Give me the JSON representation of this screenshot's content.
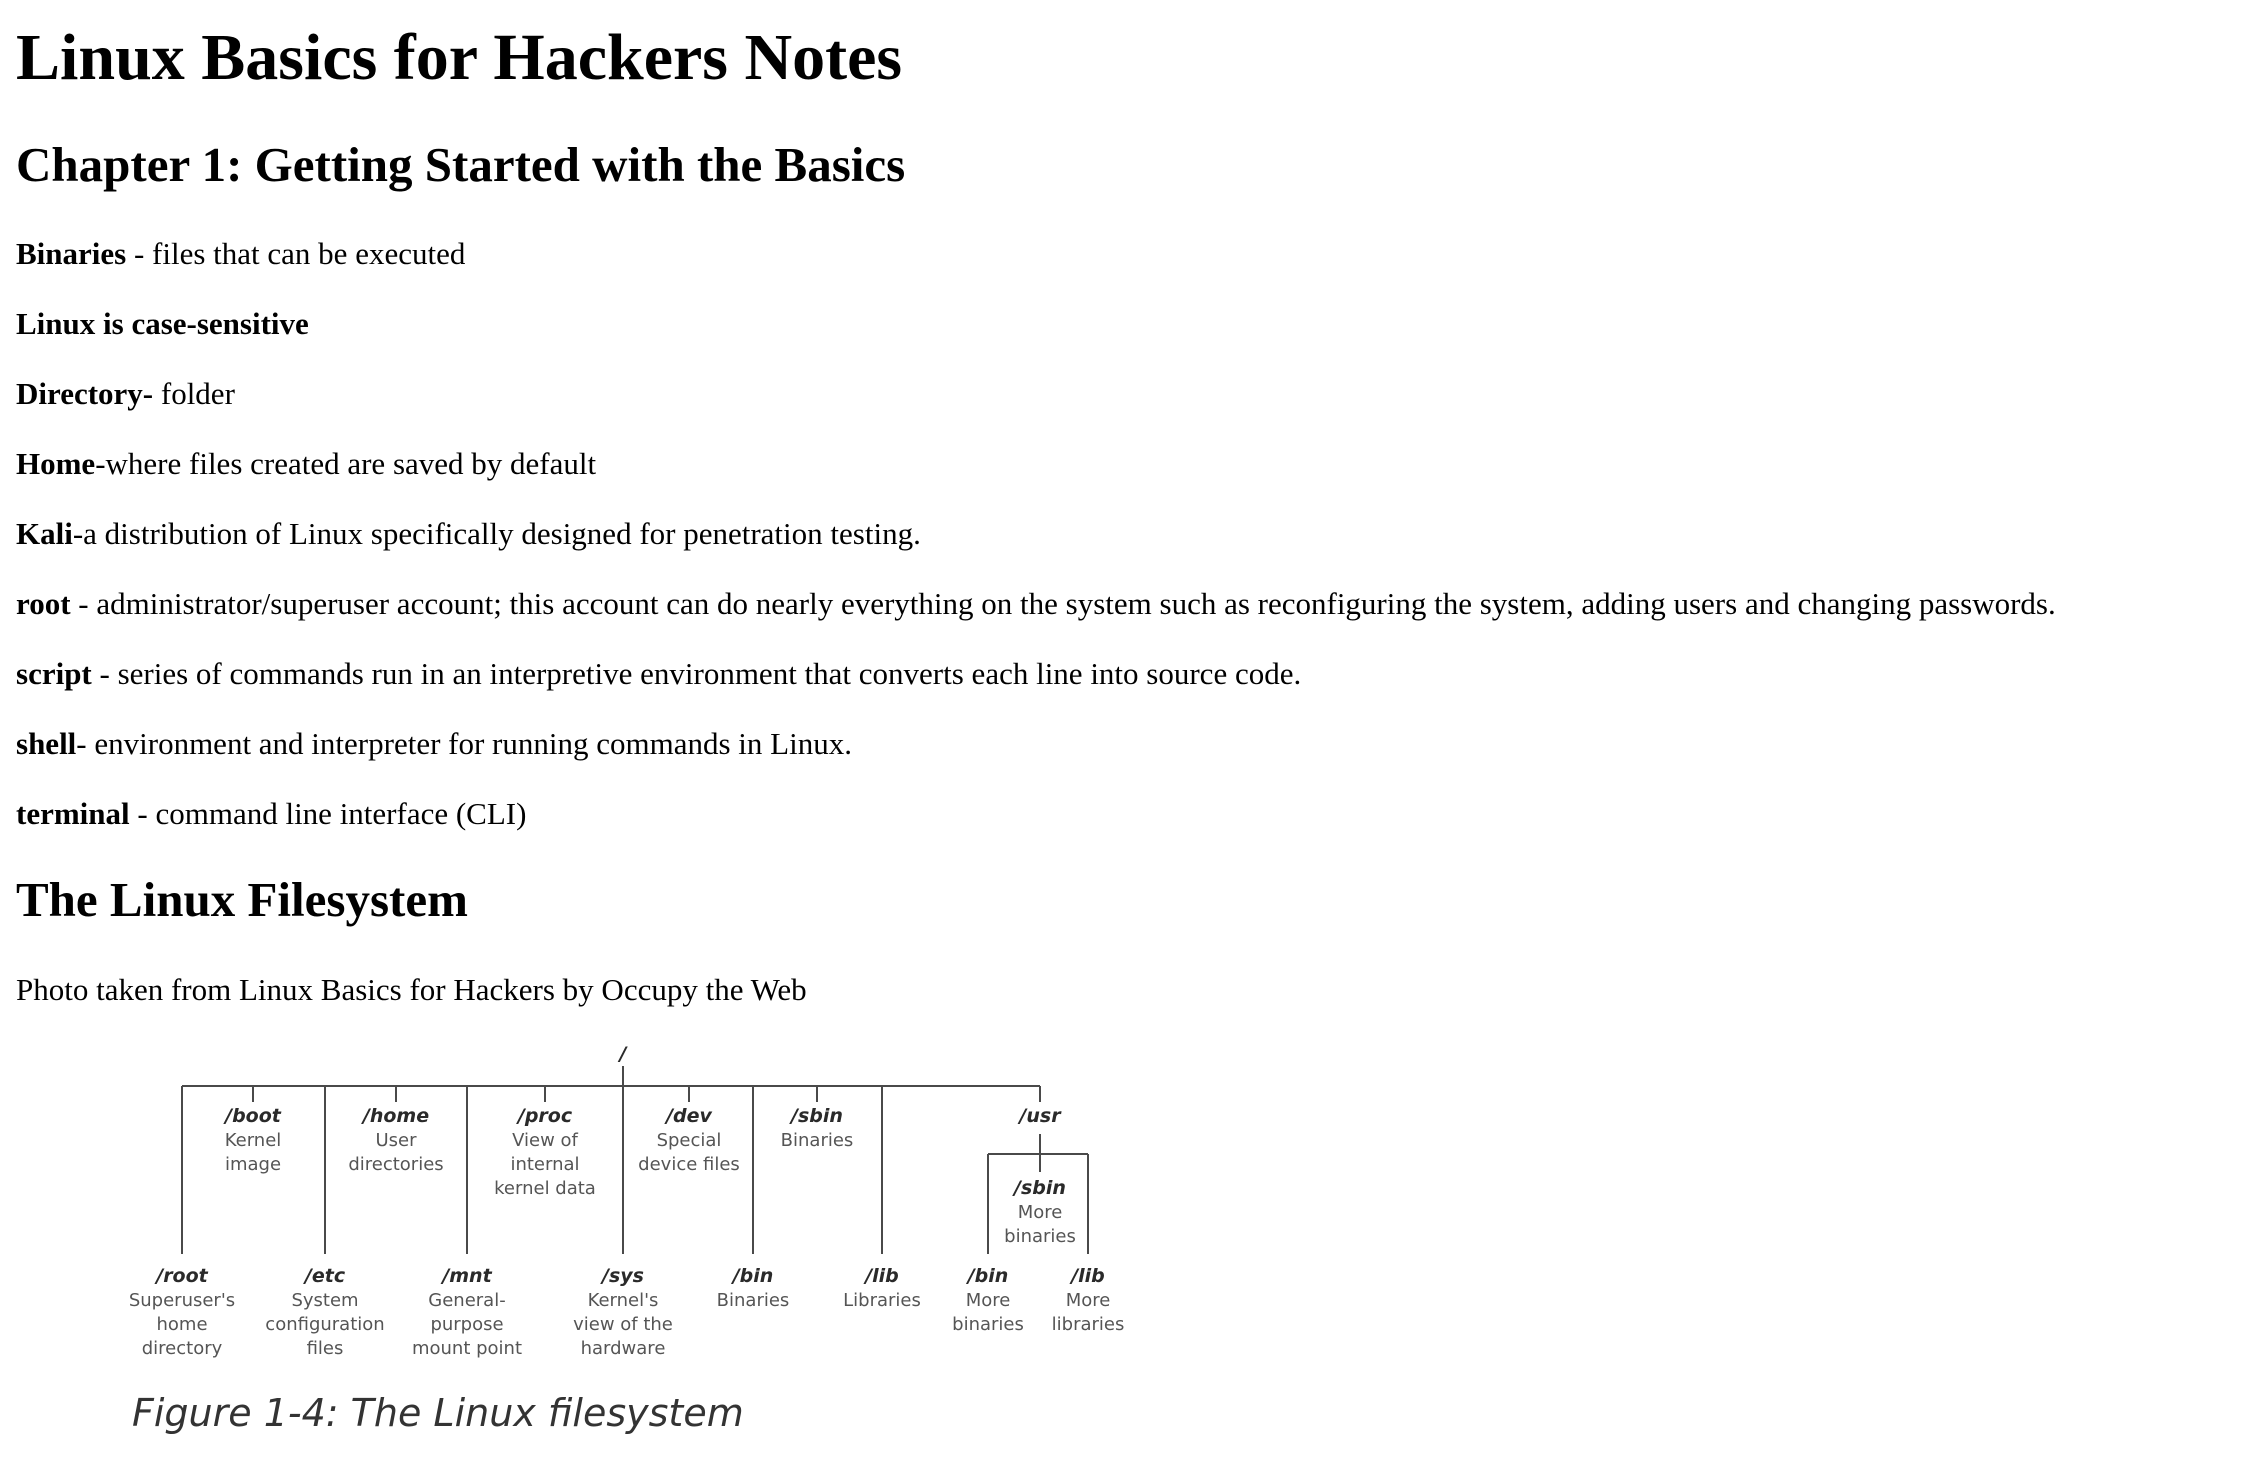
{
  "title": "Linux Basics for Hackers Notes",
  "chapter1": {
    "heading": "Chapter 1: Getting Started with the Basics",
    "definitions": [
      {
        "term": "Binaries",
        "text": " - files that can be executed"
      },
      {
        "term": "Linux is case-sensitive",
        "text": ""
      },
      {
        "term": "Directory-",
        "text": " folder"
      },
      {
        "term": "Home",
        "text": "-where files created are saved by default"
      },
      {
        "term": "Kali",
        "text": "-a distribution of Linux specifically designed for penetration testing."
      },
      {
        "term": "root",
        "text": " - administrator/superuser account; this account can do nearly everything on the system such as reconfiguring the system, adding users and changing passwords."
      },
      {
        "term": "script",
        "text": " - series of commands run in an interpretive environment that converts each line into source code."
      },
      {
        "term": "shell",
        "text": "- environment and interpreter for running commands in Linux."
      },
      {
        "term": "terminal",
        "text": " - command line interface (CLI)"
      }
    ]
  },
  "filesystem": {
    "heading": "The Linux Filesystem",
    "credit": "Photo taken from Linux Basics for Hackers by Occupy the Web",
    "figure": {
      "root_label": "/",
      "upper": [
        {
          "name": "/boot",
          "desc": [
            "Kernel",
            "image"
          ]
        },
        {
          "name": "/home",
          "desc": [
            "User",
            "directories"
          ]
        },
        {
          "name": "/proc",
          "desc": [
            "View of",
            "internal",
            "kernel data"
          ]
        },
        {
          "name": "/dev",
          "desc": [
            "Special",
            "device files"
          ]
        },
        {
          "name": "/sbin",
          "desc": [
            "Binaries"
          ]
        },
        {
          "name": "/usr",
          "desc": []
        }
      ],
      "usr_sbin": {
        "name": "/sbin",
        "desc": [
          "More",
          "binaries"
        ]
      },
      "lower": [
        {
          "name": "/root",
          "desc": [
            "Superuser's",
            "home",
            "directory"
          ]
        },
        {
          "name": "/etc",
          "desc": [
            "System",
            "configuration",
            "files"
          ]
        },
        {
          "name": "/mnt",
          "desc": [
            "General-",
            "purpose",
            "mount point"
          ]
        },
        {
          "name": "/sys",
          "desc": [
            "Kernel's",
            "view of the",
            "hardware"
          ]
        },
        {
          "name": "/bin",
          "desc": [
            "Binaries"
          ]
        },
        {
          "name": "/lib",
          "desc": [
            "Libraries"
          ]
        },
        {
          "name": "/bin",
          "desc": [
            "More",
            "binaries"
          ]
        },
        {
          "name": "/lib",
          "desc": [
            "More",
            "libraries"
          ]
        }
      ],
      "caption": "Figure 1-4: The Linux filesystem"
    }
  }
}
